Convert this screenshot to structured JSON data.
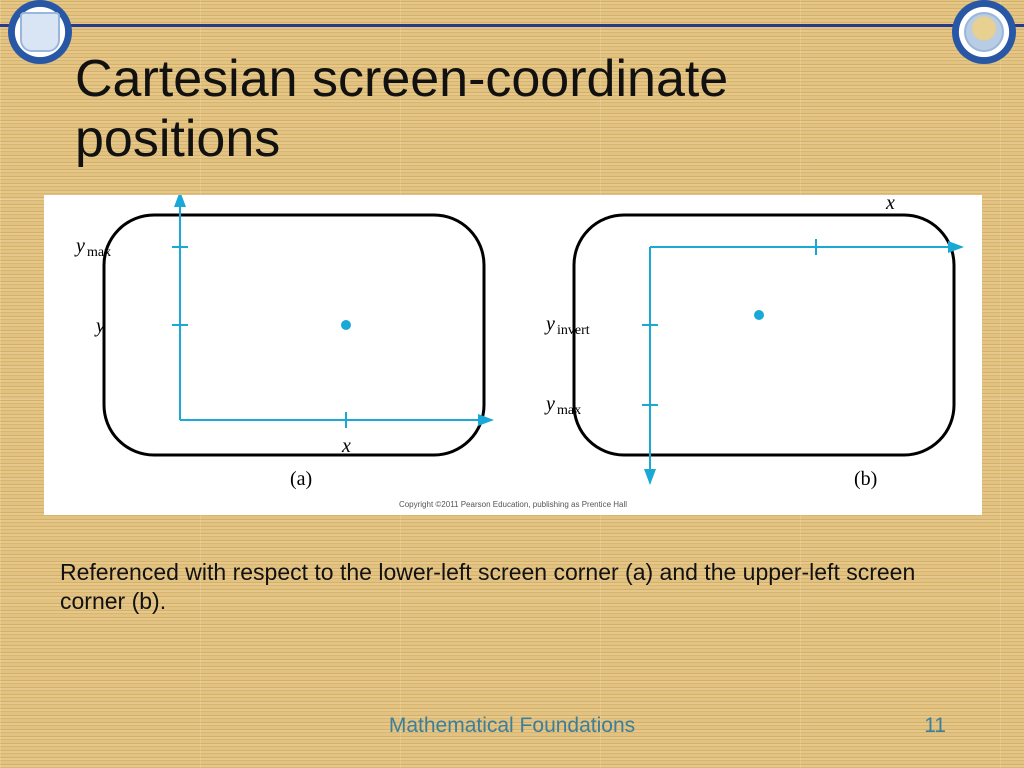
{
  "title": "Cartesian screen-coordinate positions",
  "figure": {
    "left": {
      "label": "(a)",
      "x_axis_label": "x",
      "y_axis_label_top": "y_max",
      "y_axis_label_mid": "y"
    },
    "right": {
      "label": "(b)",
      "x_axis_label": "x",
      "y_axis_label_mid": "y_invert",
      "y_axis_label_bottom": "y_max"
    },
    "copyright": "Copyright ©2011 Pearson Education, publishing as Prentice Hall"
  },
  "caption": "Referenced with respect to the lower-left screen corner (a) and the upper-left screen corner (b).",
  "footer": {
    "center": "Mathematical Foundations",
    "page": "11"
  }
}
